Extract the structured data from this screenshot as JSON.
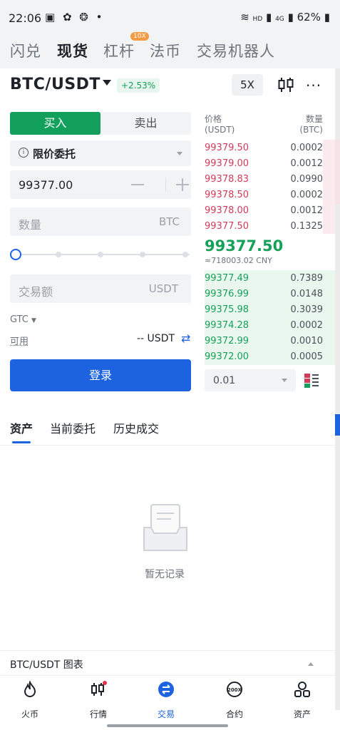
{
  "status_bar": {
    "time": "22:06",
    "left_icons": "▣ ✿ ❂ •",
    "signal_text": "HD",
    "network": "4G",
    "battery": "62%"
  },
  "top_tabs": {
    "items": [
      {
        "label": "闪兑"
      },
      {
        "label": "现货"
      },
      {
        "label": "杠杆"
      },
      {
        "label": "法币"
      },
      {
        "label": "交易机器人"
      }
    ],
    "badge": "10X",
    "active_index": 1
  },
  "pair": {
    "symbol": "BTC/USDT",
    "change": "+2.53%",
    "leverage": "5X",
    "more": "···"
  },
  "form": {
    "buy_label": "买入",
    "sell_label": "卖出",
    "order_type": "限价委托",
    "info_icon": "i",
    "price": "99377.00",
    "qty_placeholder": "数量",
    "qty_unit": "BTC",
    "slider_value_pct": 0,
    "amount_placeholder": "交易额",
    "amount_unit": "USDT",
    "tif": "GTC",
    "available_label": "可用",
    "available_value": "-- USDT",
    "swap_icon": "⇄",
    "login_label": "登录"
  },
  "orderbook": {
    "price_header": "价格",
    "price_unit": "(USDT)",
    "qty_header": "数量",
    "qty_unit": "(BTC)",
    "asks": [
      {
        "price": "99379.50",
        "qty": "0.0002"
      },
      {
        "price": "99379.00",
        "qty": "0.0012"
      },
      {
        "price": "99378.83",
        "qty": "0.0990"
      },
      {
        "price": "99378.50",
        "qty": "0.0002"
      },
      {
        "price": "99378.00",
        "qty": "0.0012"
      },
      {
        "price": "99377.50",
        "qty": "0.1325"
      }
    ],
    "last_price": "99377.50",
    "last_cny": "≈718003.02 CNY",
    "bids": [
      {
        "price": "99377.49",
        "qty": "0.7389"
      },
      {
        "price": "99376.99",
        "qty": "0.0148"
      },
      {
        "price": "99375.98",
        "qty": "0.3039"
      },
      {
        "price": "99374.28",
        "qty": "0.0002"
      },
      {
        "price": "99372.99",
        "qty": "0.0010"
      },
      {
        "price": "99372.00",
        "qty": "0.0005"
      }
    ],
    "depth_step": "0.01"
  },
  "bottom_tabs": {
    "items": [
      {
        "label": "资产"
      },
      {
        "label": "当前委托"
      },
      {
        "label": "历史成交"
      }
    ],
    "active_index": 0
  },
  "empty_state": {
    "text": "暂无记录"
  },
  "chart_bar": {
    "title": "BTC/USDT 图表"
  },
  "bottom_nav": {
    "items": [
      {
        "label": "火币",
        "icon": "flame-icon"
      },
      {
        "label": "行情",
        "icon": "candlestick-icon"
      },
      {
        "label": "交易",
        "icon": "swap-icon"
      },
      {
        "label": "合约",
        "icon": "contract-200x-icon"
      },
      {
        "label": "资产",
        "icon": "assets-icon"
      }
    ],
    "active_index": 2
  },
  "colors": {
    "buy_green": "#12a05c",
    "sell_red": "#d13b57",
    "accent_blue": "#1d63e0"
  }
}
